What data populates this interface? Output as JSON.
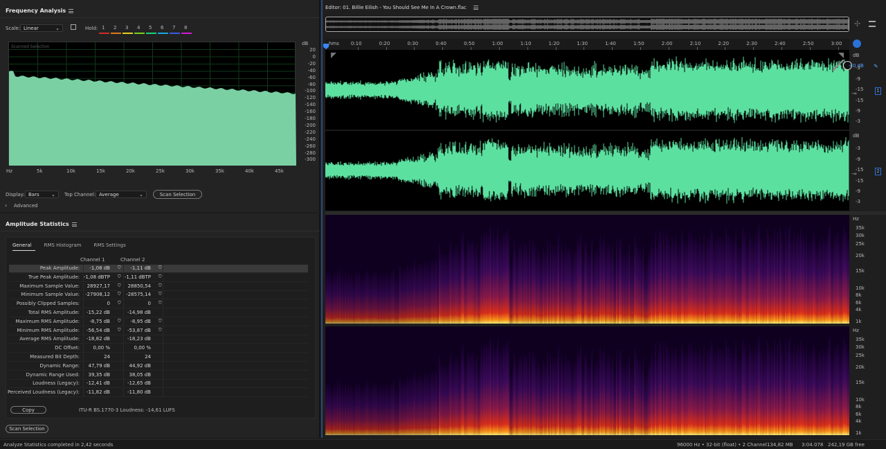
{
  "freq_panel": {
    "title": "Frequency Analysis",
    "scale_label": "Scale:",
    "scale_value": "Linear",
    "hold_label": "Hold:",
    "hold_buttons": [
      "1",
      "2",
      "3",
      "4",
      "5",
      "6",
      "7",
      "8"
    ],
    "hold_colors": [
      "#d42b2b",
      "#e07a1a",
      "#e0d21a",
      "#7ad21a",
      "#1ad27a",
      "#1aa8e0",
      "#3a5ae0",
      "#d21ad2"
    ],
    "graph_label": "Scanned Selection",
    "db_unit": "dB",
    "db_ticks": [
      "20",
      "0",
      "-20",
      "-40",
      "-60",
      "-80",
      "-100",
      "-120",
      "-140",
      "-160",
      "-180",
      "-200",
      "-220",
      "-240",
      "-260",
      "-280",
      "-300"
    ],
    "hz_unit": "Hz",
    "hz_ticks": [
      "5k",
      "10k",
      "15k",
      "20k",
      "25k",
      "30k",
      "35k",
      "40k",
      "45k"
    ],
    "display_label": "Display:",
    "display_value": "Bars",
    "top_channel_label": "Top Channel:",
    "top_channel_value": "Average",
    "scan_button": "Scan Selection",
    "advanced_label": "Advanced",
    "fill_color": "#7ad0a3"
  },
  "amp_panel": {
    "title": "Amplitude Statistics",
    "tabs": [
      "General",
      "RMS Histogram",
      "RMS Settings"
    ],
    "ch1_header": "Channel 1",
    "ch2_header": "Channel 2",
    "rows": [
      {
        "label": "Peak Amplitude:",
        "c1": "-1,08 dB",
        "c2": "-1,11 dB",
        "flag": true
      },
      {
        "label": "True Peak Amplitude:",
        "c1": "-1,08 dBTP",
        "c2": "-1,11 dBTP",
        "flag": true
      },
      {
        "label": "Maximum Sample Value:",
        "c1": "28927,17",
        "c2": "28850,54",
        "flag": true
      },
      {
        "label": "Minimum Sample Value:",
        "c1": "-27908,12",
        "c2": "-28575,14",
        "flag": true
      },
      {
        "label": "Possibly Clipped Samples:",
        "c1": "0",
        "c2": "0",
        "flag": true
      },
      {
        "label": "Total RMS Amplitude:",
        "c1": "-15,22 dB",
        "c2": "-14,98 dB",
        "flag": false
      },
      {
        "label": "Maximum RMS Amplitude:",
        "c1": "-8,75 dB",
        "c2": "-8,95 dB",
        "flag": true
      },
      {
        "label": "Minimum RMS Amplitude:",
        "c1": "-56,54 dB",
        "c2": "-53,87 dB",
        "flag": true
      },
      {
        "label": "Average RMS Amplitude:",
        "c1": "-18,82 dB",
        "c2": "-18,23 dB",
        "flag": false
      },
      {
        "label": "DC Offset:",
        "c1": "0,00 %",
        "c2": "0,00 %",
        "flag": false
      },
      {
        "label": "Measured Bit Depth:",
        "c1": "24",
        "c2": "24",
        "flag": false
      },
      {
        "label": "Dynamic Range:",
        "c1": "47,79 dB",
        "c2": "44,92 dB",
        "flag": false
      },
      {
        "label": "Dynamic Range Used:",
        "c1": "39,35 dB",
        "c2": "38,05 dB",
        "flag": false
      },
      {
        "label": "Loudness (Legacy):",
        "c1": "-12,41 dB",
        "c2": "-12,65 dB",
        "flag": false
      },
      {
        "label": "Perceived Loudness (Legacy):",
        "c1": "-11,82 dB",
        "c2": "-11,80 dB",
        "flag": false
      }
    ],
    "copy_button": "Copy",
    "itu_text": "ITU-R BS.1770-3 Loudness: -14,61 LUFS",
    "scan_button": "Scan Selection"
  },
  "editor": {
    "title": "Editor: 01. Billie Eilish - You Should See Me In A Crown.flac",
    "time_unit": "hms",
    "time_ticks": [
      "0:10",
      "0:20",
      "0:30",
      "0:40",
      "0:50",
      "1:00",
      "1:10",
      "1:20",
      "1:30",
      "1:40",
      "1:50",
      "2:00",
      "2:10",
      "2:20",
      "2:30",
      "2:40",
      "2:50",
      "3:00"
    ],
    "wave_color": "#5ce0a0",
    "ch1_db_ticks": [
      "dB",
      "-3",
      "-9",
      "-15",
      "-∞",
      "-15",
      "-9",
      "-3"
    ],
    "ch2_db_ticks": [
      "dB",
      "-3",
      "-9",
      "-15",
      "-∞",
      "-15",
      "-9",
      "-3"
    ],
    "volume_readout": "+0 dB",
    "ch1_badge": "1",
    "ch2_badge": "2",
    "spec_ticks": [
      "Hz",
      "35k",
      "30k",
      "25k",
      "20k",
      "15k",
      "10k",
      "8k",
      "6k",
      "4k",
      "1k"
    ]
  },
  "status_bar": {
    "message": "Analyze Statistics completed in 2,42 seconds",
    "format": "96000 Hz • 32-bit (float) • 2 Channel",
    "size": "134,82 MB",
    "duration": "3:04.078",
    "free": "242,19 GB free"
  }
}
